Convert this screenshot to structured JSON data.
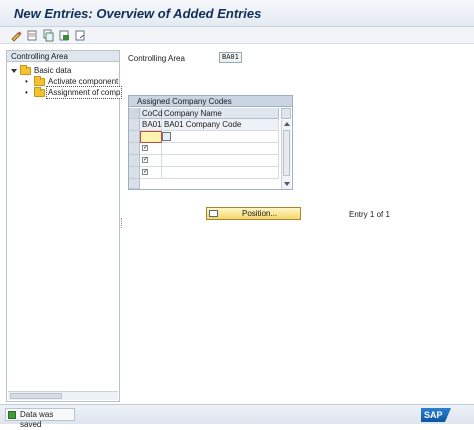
{
  "window": {
    "title": "New Entries: Overview of Added Entries"
  },
  "toolbar": {
    "icons": [
      "change-display-icon",
      "new-entries-icon",
      "copy-as-icon",
      "delete-icon",
      "undo-icon"
    ]
  },
  "nav": {
    "header": "Controlling Area",
    "items": [
      {
        "label": "Basic data",
        "level": 0
      },
      {
        "label": "Activate component",
        "level": 1
      },
      {
        "label": "Assignment of comp",
        "level": 1
      }
    ]
  },
  "main": {
    "controlling_area_label": "Controlling Area",
    "controlling_area_value": "BA01",
    "table": {
      "title": "Assigned Company Codes",
      "columns": [
        "CoCd",
        "Company Name"
      ],
      "rows": [
        {
          "cocd": "BA01",
          "name": "BA01 Company Code",
          "checked": false
        },
        {
          "cocd": "",
          "name": "",
          "checked": false
        },
        {
          "cocd": "",
          "name": "",
          "checked": true
        },
        {
          "cocd": "",
          "name": "",
          "checked": true
        },
        {
          "cocd": "",
          "name": "",
          "checked": true
        }
      ]
    },
    "position_button": "Position...",
    "entry_info": "Entry 1 of 1"
  },
  "status": {
    "message": "Data was saved",
    "logo": "SAP"
  },
  "colors": {
    "title": "#0f2f56",
    "folder": "#f2c230",
    "button": "#f3d66b",
    "success": "#3f9b3c",
    "sap_blue": "#0d56a4"
  }
}
